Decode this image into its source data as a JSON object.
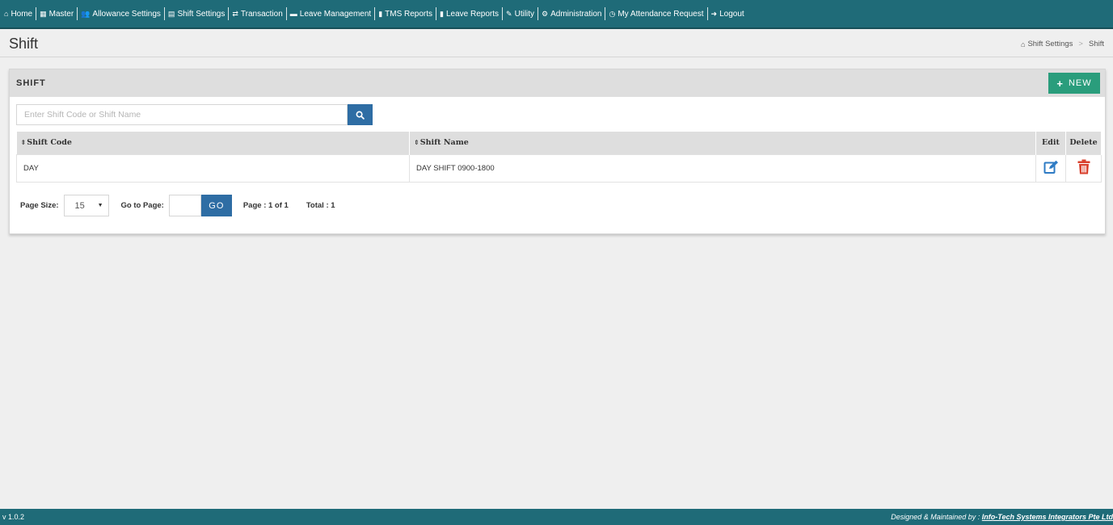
{
  "nav": {
    "items": [
      {
        "label": "Home",
        "icon": "home-icon",
        "glyph": "⌂"
      },
      {
        "label": "Master",
        "icon": "grid-icon",
        "glyph": "▦"
      },
      {
        "label": "Allowance Settings",
        "icon": "users-icon",
        "glyph": "👥"
      },
      {
        "label": "Shift Settings",
        "icon": "calendar-icon",
        "glyph": "▤"
      },
      {
        "label": "Transaction",
        "icon": "exchange-icon",
        "glyph": "⇄"
      },
      {
        "label": "Leave Management",
        "icon": "card-icon",
        "glyph": "▬"
      },
      {
        "label": "TMS Reports",
        "icon": "file-icon",
        "glyph": "▮"
      },
      {
        "label": "Leave Reports",
        "icon": "file-icon",
        "glyph": "▮"
      },
      {
        "label": "Utility",
        "icon": "wrench-icon",
        "glyph": "✎"
      },
      {
        "label": "Administration",
        "icon": "cogs-icon",
        "glyph": "⚙"
      },
      {
        "label": "My Attendance Request",
        "icon": "clock-icon",
        "glyph": "◷"
      },
      {
        "label": "Logout",
        "icon": "logout-icon",
        "glyph": "➜"
      }
    ]
  },
  "header": {
    "title": "Shift",
    "breadcrumb": {
      "parent": "Shift Settings",
      "separator": ">",
      "current": "Shift"
    }
  },
  "panel": {
    "title": "SHIFT",
    "new_label": "NEW",
    "search": {
      "placeholder": "Enter Shift Code or Shift Name",
      "value": ""
    }
  },
  "table": {
    "columns": {
      "code": "Shift Code",
      "name": "Shift Name",
      "edit": "Edit",
      "delete": "Delete"
    },
    "rows": [
      {
        "code": "DAY",
        "name": "DAY SHIFT 0900-1800"
      }
    ]
  },
  "pager": {
    "page_size_label": "Page Size:",
    "page_size_value": "15",
    "goto_label": "Go to Page:",
    "go_label": "GO",
    "page_info": "Page : 1 of 1",
    "total_info": "Total : 1"
  },
  "footer": {
    "version": "v 1.0.2",
    "credit_prefix": "Designed & Maintained by :",
    "credit_link": "Info-Tech Systems Integrators Pte Ltd"
  },
  "colors": {
    "nav_bg": "#1f6b78",
    "new_button": "#2a9d7c",
    "primary_button": "#2e6da4",
    "edit_icon": "#2e7bc4",
    "delete_icon": "#d9412e"
  }
}
